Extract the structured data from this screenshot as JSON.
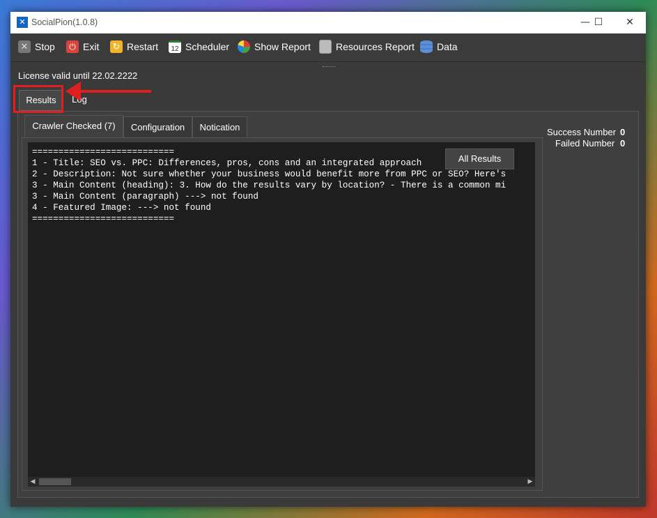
{
  "window": {
    "title": "SocialPion(1.0.8)"
  },
  "toolbar": {
    "buttons": [
      {
        "label": "Stop",
        "icon": "stop-icon"
      },
      {
        "label": "Exit",
        "icon": "power-icon"
      },
      {
        "label": "Restart",
        "icon": "restart-icon"
      },
      {
        "label": "Scheduler",
        "icon": "calendar-icon"
      },
      {
        "label": "Show Report",
        "icon": "pie-chart-icon"
      },
      {
        "label": "Resources Report",
        "icon": "document-icon"
      },
      {
        "label": "Data",
        "icon": "database-icon"
      }
    ],
    "calendar_day": "12"
  },
  "license": "License valid until 22.02.2222",
  "outer_tabs": [
    "Results",
    "Log"
  ],
  "inner_tabs": [
    "Crawler Checked (7)",
    "Configuration",
    "Notication"
  ],
  "results": {
    "lines": [
      "===========================",
      "1 - Title: SEO vs. PPC: Differences, pros, cons and an integrated approach",
      "2 - Description: Not sure whether your business would benefit more from PPC or SEO? Here's",
      "3 - Main Content (heading): 3. How do the results vary by location? - There is a common mi",
      "3 - Main Content (paragraph) ---> not found",
      "4 - Featured Image: ---> not found",
      "==========================="
    ],
    "all_results_label": "All Results"
  },
  "stats": {
    "success_label": "Success Number",
    "success_value": "0",
    "failed_label": "Failed Number",
    "failed_value": "0"
  },
  "colors": {
    "highlight": "#e02020",
    "panel": "#3f3f3f",
    "console": "#1e1e1e"
  }
}
